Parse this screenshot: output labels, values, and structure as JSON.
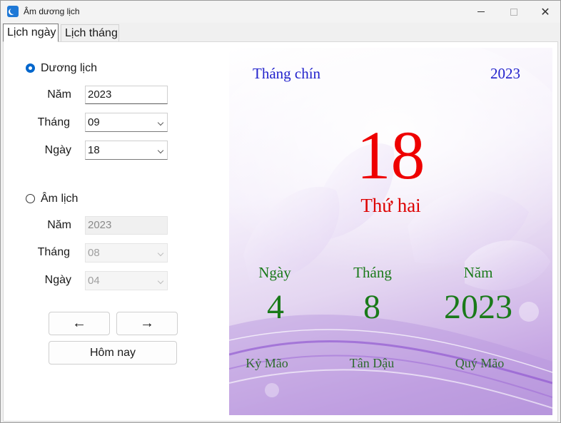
{
  "window": {
    "title": "Âm dương lịch"
  },
  "tabs": [
    {
      "label": "Lịch ngày"
    },
    {
      "label": "Lịch tháng"
    }
  ],
  "solar": {
    "radio_label": "Dương lịch",
    "selected": true,
    "year_label": "Năm",
    "year_value": "2023",
    "month_label": "Tháng",
    "month_value": "09",
    "day_label": "Ngày",
    "day_value": "18"
  },
  "lunar": {
    "radio_label": "Âm lịch",
    "selected": false,
    "year_label": "Năm",
    "year_value": "2023",
    "month_label": "Tháng",
    "month_value": "08",
    "day_label": "Ngày",
    "day_value": "04"
  },
  "buttons": {
    "prev": "←",
    "next": "→",
    "today": "Hôm nay"
  },
  "calendar": {
    "month_text": "Tháng chín",
    "year_text": "2023",
    "day": "18",
    "weekday": "Thứ hai",
    "lunar": {
      "day_label": "Ngày",
      "month_label": "Tháng",
      "year_label": "Năm",
      "day": "4",
      "month": "8",
      "year": "2023",
      "day_canchi": "Kỷ Mão",
      "month_canchi": "Tân Dậu",
      "year_canchi": "Quý Mão"
    }
  },
  "icons": {
    "app": "crescent-moon-icon",
    "minimize": "minimize-icon",
    "maximize": "maximize-icon",
    "close": "close-icon"
  },
  "colors": {
    "accent": "#0066cc",
    "month_text": "#2222cc",
    "day_number": "#ee0000",
    "lunar_text": "#1a7a1a"
  }
}
